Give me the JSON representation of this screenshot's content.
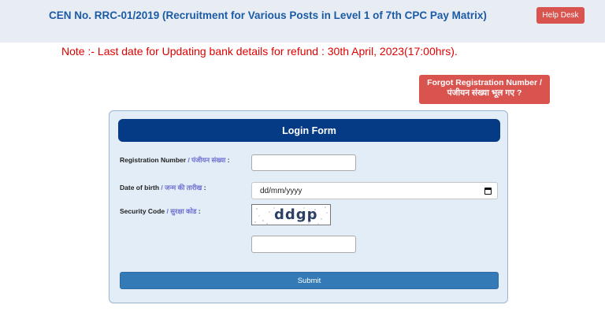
{
  "header": {
    "title": "CEN No. RRC-01/2019 (Recruitment for Various Posts in Level 1 of 7th CPC Pay Matrix)",
    "help_label": "Help Desk"
  },
  "note": "Note :- Last date for Updating bank details for refund : 30th April, 2023(17:00hrs).",
  "forgot": {
    "line1": "Forgot Registration Number /",
    "line2": "पंजीयन संख्या भूल गए ?"
  },
  "login": {
    "title": "Login Form",
    "registration": {
      "label_en": "Registration Number",
      "label_hi": " / पंजीयन संख्या",
      "suffix": " :",
      "value": ""
    },
    "dob": {
      "label_en": "Date of birth",
      "label_hi": " / जन्म की तारीख",
      "suffix": " :",
      "placeholder": "dd/mm/yyyy"
    },
    "security": {
      "label_en": "Security Code",
      "label_hi": " / सुरक्षा कोड",
      "suffix": " :",
      "captcha": "ddgp",
      "value": ""
    },
    "submit_label": "Submit"
  }
}
